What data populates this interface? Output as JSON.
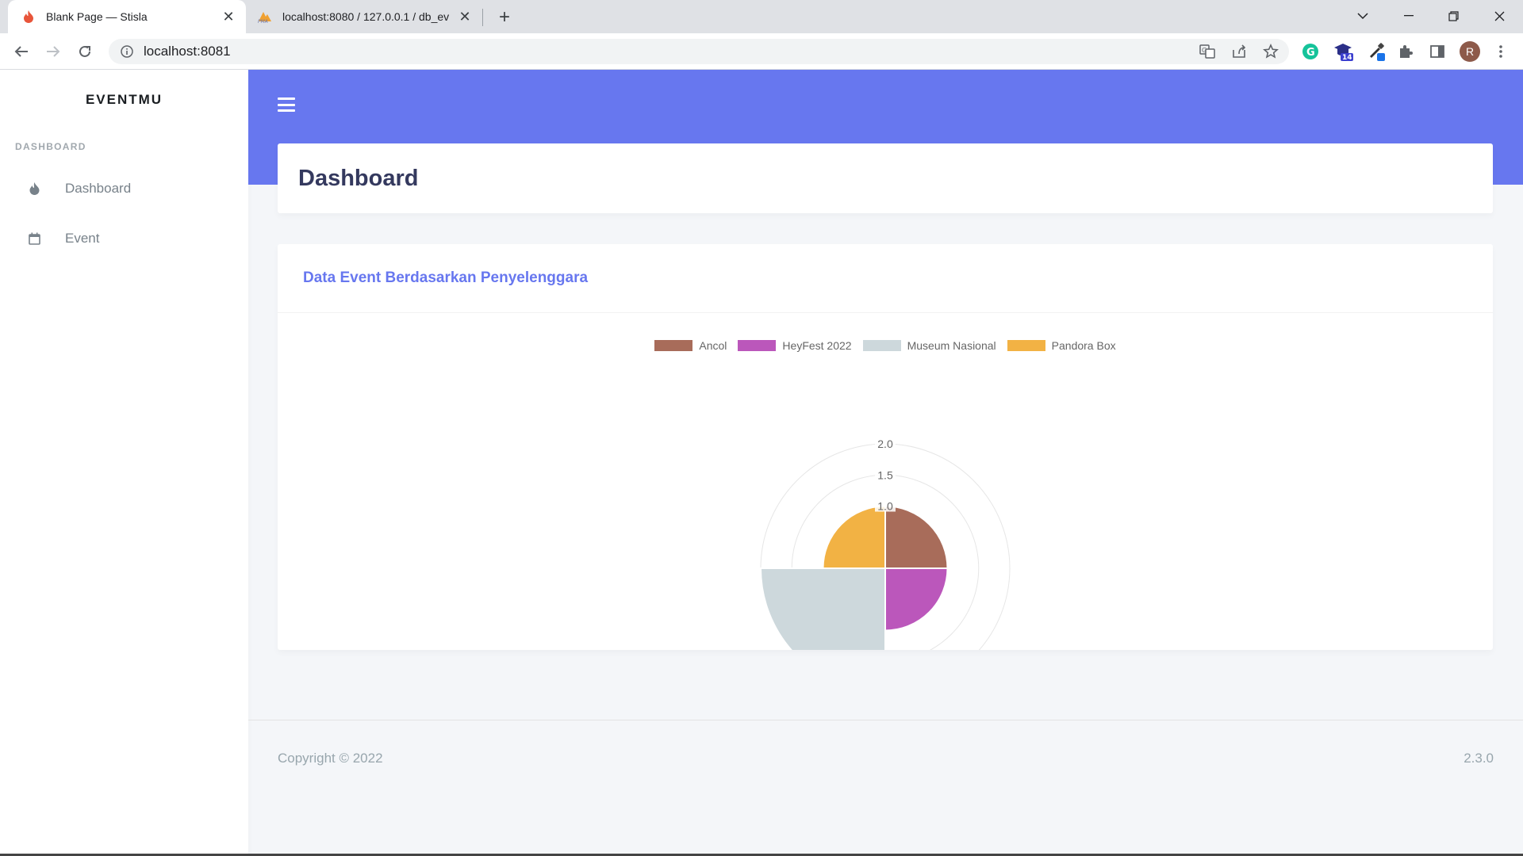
{
  "browser": {
    "tabs": [
      {
        "title": "Blank Page — Stisla",
        "active": true
      },
      {
        "title": "localhost:8080 / 127.0.0.1 / db_ev",
        "active": false
      }
    ],
    "url": "localhost:8081",
    "profile_initial": "R",
    "extension_badge": "14"
  },
  "sidebar": {
    "brand": "EVENTMU",
    "menu_header": "DASHBOARD",
    "items": [
      {
        "label": "Dashboard",
        "icon": "fire-icon"
      },
      {
        "label": "Event",
        "icon": "calendar-icon"
      }
    ]
  },
  "page": {
    "title": "Dashboard"
  },
  "card": {
    "title": "Data Event Berdasarkan Penyelenggara"
  },
  "chart_data": {
    "type": "polarArea",
    "categories": [
      "Ancol",
      "HeyFest 2022",
      "Museum Nasional",
      "Pandora Box"
    ],
    "values": [
      1,
      1,
      2,
      1
    ],
    "colors": [
      "#a86c5a",
      "#bb57bb",
      "#cdd8dc",
      "#f2b244"
    ],
    "ticks": [
      "2.0",
      "1.5",
      "1.0"
    ],
    "rlim": [
      0,
      2
    ],
    "legend_position": "top"
  },
  "footer": {
    "copyright": "Copyright © 2022",
    "version": "2.3.0"
  },
  "colors": {
    "primary": "#6777ef",
    "background": "#f4f6f9"
  }
}
